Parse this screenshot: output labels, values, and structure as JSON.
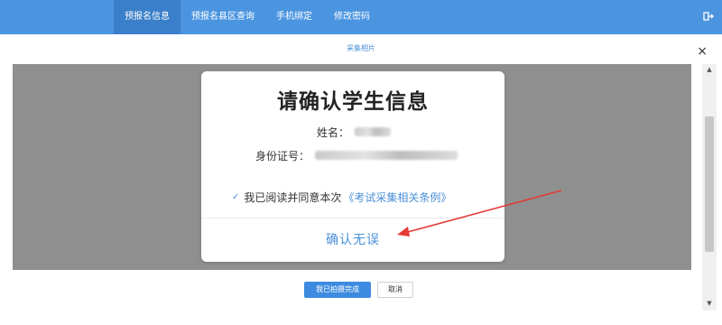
{
  "nav": {
    "items": [
      {
        "label": "预报名信息"
      },
      {
        "label": "预报名县区查询"
      },
      {
        "label": "手机绑定"
      },
      {
        "label": "修改密码"
      }
    ],
    "logout_icon": "logout-icon"
  },
  "dialog": {
    "title": "采集相片",
    "close_glyph": "×"
  },
  "card": {
    "title": "请确认学生信息",
    "name_label": "姓名：",
    "id_label": "身份证号：",
    "agree_check": "✓",
    "agree_text": "我已阅读并同意本次",
    "terms_link": "《考试采集相关条例》",
    "confirm_label": "确认无误"
  },
  "scrollbar": {
    "up_glyph": "▲",
    "down_glyph": "▼"
  },
  "footer": {
    "done_label": "我已拍摄完成",
    "cancel_label": "取消"
  },
  "colors": {
    "accent": "#4b95e0",
    "annotation_arrow": "#e53935"
  }
}
